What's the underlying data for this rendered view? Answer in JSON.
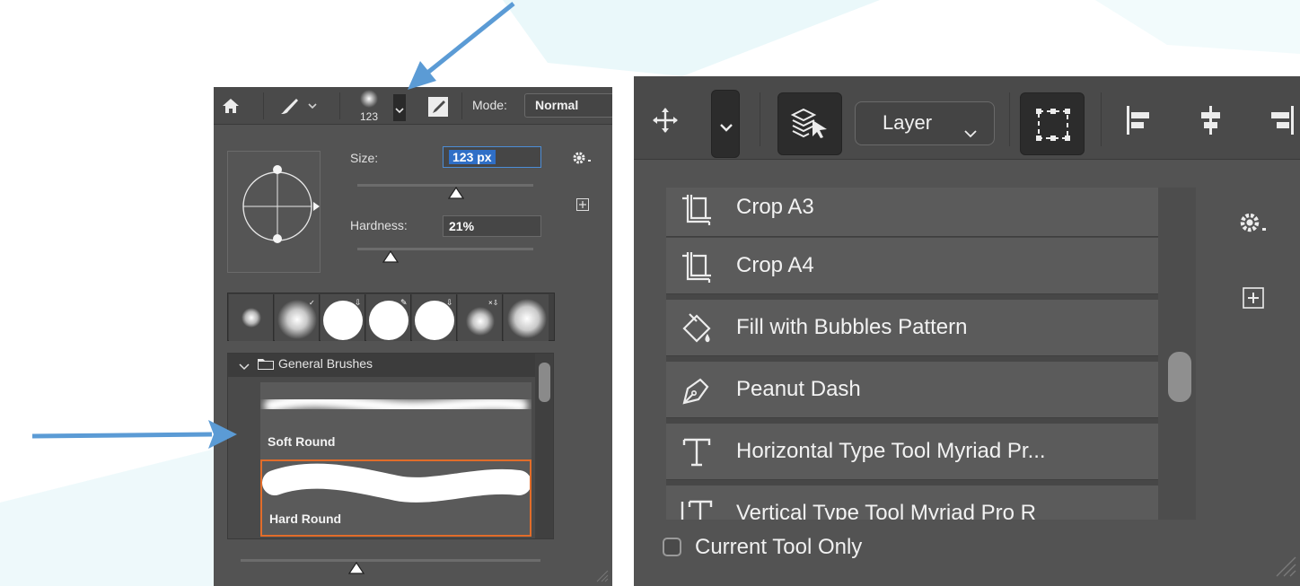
{
  "left_panel": {
    "toolbar": {
      "home_icon": "home-icon",
      "brush_tool_icon": "brush-icon",
      "brush_preset_size": "123",
      "toggle_icon": "brush-settings-toggle-icon",
      "mode_label": "Mode:",
      "mode_value": "Normal"
    },
    "brush_picker": {
      "size_label": "Size:",
      "size_value": "123 px",
      "hardness_label": "Hardness:",
      "hardness_value": "21%",
      "size_slider": 0.52,
      "hardness_slider": 0.21,
      "gear_icon": "gear-icon",
      "new_preset_icon": "plus-square-icon"
    },
    "recent_tips_count": 7,
    "brush_list": {
      "group_label": "General Brushes",
      "items": [
        {
          "label": "Soft Round",
          "selected": false
        },
        {
          "label": "Hard Round",
          "selected": true
        }
      ]
    },
    "bottom_slider": 0.38
  },
  "right_panel": {
    "toolbar": {
      "move_icon": "move-icon",
      "auto_select_icon": "layers-select-icon",
      "auto_select_value": "Layer",
      "transform_controls_icon": "transform-controls-icon",
      "align_icons": [
        "align-left-icon",
        "align-center-icon",
        "align-right-icon"
      ]
    },
    "tool_presets": [
      {
        "icon": "crop-icon",
        "label": "Crop A3"
      },
      {
        "icon": "crop-icon",
        "label": "Crop A4"
      },
      {
        "icon": "paint-bucket-icon",
        "label": "Fill with Bubbles Pattern"
      },
      {
        "icon": "pen-icon",
        "label": "Peanut Dash"
      },
      {
        "icon": "type-icon",
        "label": "Horizontal Type Tool Myriad Pr..."
      },
      {
        "icon": "vertical-type-icon",
        "label": "Vertical Type Tool Myriad Pro R"
      }
    ],
    "current_tool_only_label": "Current Tool Only",
    "current_tool_only_checked": false,
    "gear_icon": "gear-icon",
    "new_preset_icon": "plus-square-icon"
  },
  "colors": {
    "panel_bg": "#535353",
    "toolbar_bg": "#4a4a4a",
    "selection_orange": "#e26d2a",
    "focus_blue": "#4c8dd6",
    "annotation_arrow": "#5b9bd5"
  }
}
